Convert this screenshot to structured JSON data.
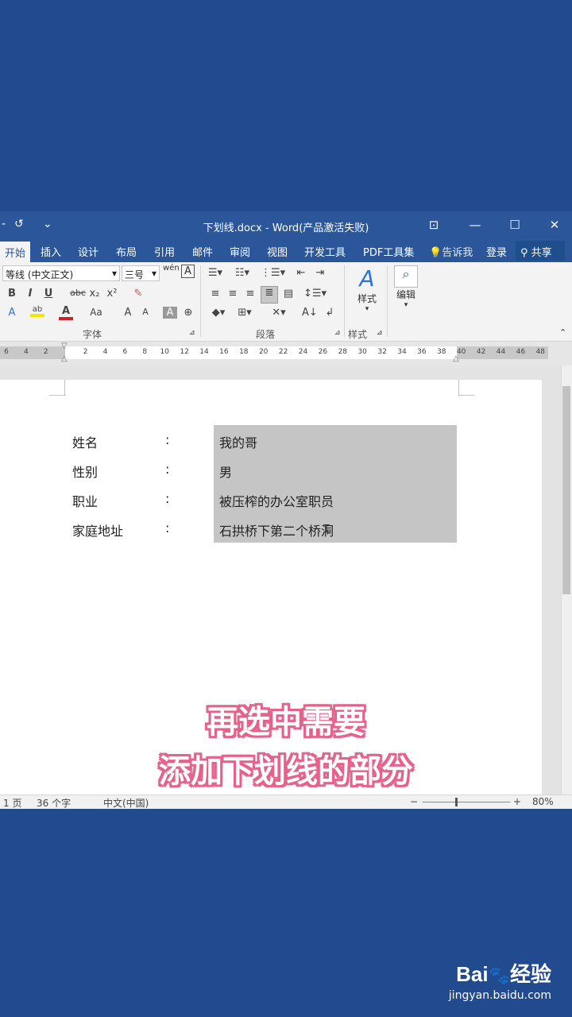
{
  "window": {
    "title": "下划线.docx - Word(产品激活失败)",
    "qat_redo": "↺",
    "qat_more": "⌄",
    "buttons": [
      "⊡",
      "—",
      "☐",
      "✕"
    ]
  },
  "tabs": [
    "开始",
    "插入",
    "设计",
    "布局",
    "引用",
    "邮件",
    "审阅",
    "视图",
    "开发工具",
    "PDF工具集"
  ],
  "active_tab": "开始",
  "tell_me": "告诉我",
  "login": "登录",
  "share": "共享",
  "ribbon": {
    "font_name": "等线 (中文正文)",
    "font_size": "三号",
    "groups": [
      "字体",
      "段落",
      "样式"
    ],
    "styles_label": "样式",
    "edit_label": "编辑",
    "font_buttons": [
      "B",
      "I",
      "U",
      "abc",
      "x₂",
      "x²"
    ],
    "font_buttons2": [
      "A",
      "ab",
      "A",
      "Aa",
      "A",
      "A",
      "A",
      "⊕"
    ],
    "wen": "wén",
    "big_a": "A"
  },
  "ruler": {
    "ticks": [
      "6",
      "4",
      "2",
      "",
      "2",
      "4",
      "6",
      "8",
      "10",
      "12",
      "14",
      "16",
      "18",
      "20",
      "22",
      "24",
      "26",
      "28",
      "30",
      "32",
      "34",
      "36",
      "38",
      "40",
      "42",
      "44",
      "46",
      "48"
    ]
  },
  "document": {
    "rows": [
      {
        "label": "姓名",
        "colon": ":",
        "value": "我的哥"
      },
      {
        "label": "性别",
        "colon": ":",
        "value": "男"
      },
      {
        "label": "职业",
        "colon": ":",
        "value": "被压榨的办公室职员"
      },
      {
        "label": "家庭地址",
        "colon": ":",
        "value": "石拱桥下第二个桥洞"
      }
    ]
  },
  "status": {
    "page": "1 页",
    "words": "36 个字",
    "language": "中文(中国)",
    "zoom_minus": "−",
    "zoom_plus": "+",
    "zoom": "80%"
  },
  "caption": {
    "line1": "再选中需要",
    "line2": "添加下划线的部分"
  },
  "watermark": {
    "brand": "Bai",
    "brand_paw": "du",
    "brand_cn": "经验",
    "url": "jingyan.baidu.com"
  },
  "colors": {
    "accent": "#2b579a",
    "background": "#214a8f",
    "selection": "#c5c5c5"
  }
}
